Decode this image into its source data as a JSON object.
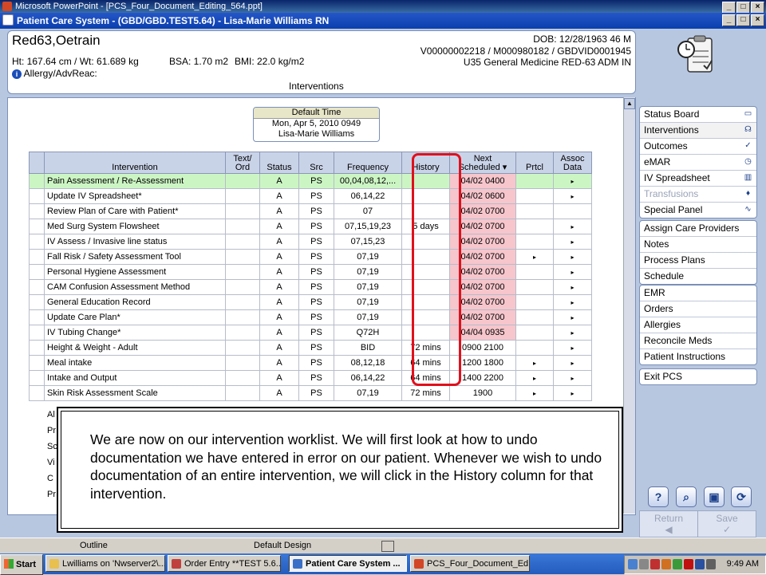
{
  "ppt_window": {
    "title": "Microsoft PowerPoint - [PCS_Four_Document_Editing_564.ppt]"
  },
  "app_window": {
    "title": "Patient Care System - (GBD/GBD.TEST5.64) - Lisa-Marie Williams RN"
  },
  "patient": {
    "name": "Red63,Oetrain",
    "vitals": "Ht: 167.64 cm / Wt: 61.689 kg",
    "bsa": "BSA: 1.70 m2",
    "bmi": "BMI: 22.0 kg/m2",
    "allergy": "Allergy/AdvReac:",
    "dob": "DOB: 12/28/1963 46 M",
    "ids": "V00000002218 / M000980182 / GBDVID0001945",
    "location": "U35 General Medicine  RED-63  ADM IN",
    "screen": "Interventions"
  },
  "default_time": {
    "header": "Default Time",
    "date": "Mon, Apr 5, 2010  0949",
    "user": "Lisa-Marie Williams"
  },
  "table": {
    "headers": {
      "intervention": "Intervention",
      "text1": "Text/",
      "text2": "Ord",
      "status": "Status",
      "src": "Src",
      "frequency": "Frequency",
      "history": "History",
      "next1": "Next",
      "next2": "Scheduled ▾",
      "prtcl": "Prtcl",
      "assoc1": "Assoc",
      "assoc2": "Data"
    },
    "rows": [
      {
        "intervention": "Pain Assessment / Re-Assessment",
        "status": "A",
        "src": "PS",
        "frequency": "00,04,08,12,...",
        "history": "",
        "next": "04/02 0400",
        "prtcl": "",
        "assoc": "▸"
      },
      {
        "intervention": "Update IV Spreadsheet*",
        "status": "A",
        "src": "PS",
        "frequency": "06,14,22",
        "history": "",
        "next": "04/02 0600",
        "prtcl": "",
        "assoc": "▸"
      },
      {
        "intervention": "Review Plan of Care with Patient*",
        "status": "A",
        "src": "PS",
        "frequency": "07",
        "history": "",
        "next": "04/02 0700",
        "prtcl": "",
        "assoc": ""
      },
      {
        "intervention": "Med Surg System Flowsheet",
        "status": "A",
        "src": "PS",
        "frequency": "07,15,19,23",
        "history": "5 days",
        "next": "04/02 0700",
        "prtcl": "",
        "assoc": "▸"
      },
      {
        "intervention": "IV Assess / Invasive line status",
        "status": "A",
        "src": "PS",
        "frequency": "07,15,23",
        "history": "",
        "next": "04/02 0700",
        "prtcl": "",
        "assoc": "▸"
      },
      {
        "intervention": "Fall Risk / Safety Assessment Tool",
        "status": "A",
        "src": "PS",
        "frequency": "07,19",
        "history": "",
        "next": "04/02 0700",
        "prtcl": "▸",
        "assoc": "▸"
      },
      {
        "intervention": "Personal Hygiene Assessment",
        "status": "A",
        "src": "PS",
        "frequency": "07,19",
        "history": "",
        "next": "04/02 0700",
        "prtcl": "",
        "assoc": "▸"
      },
      {
        "intervention": "CAM Confusion Assessment Method",
        "status": "A",
        "src": "PS",
        "frequency": "07,19",
        "history": "",
        "next": "04/02 0700",
        "prtcl": "",
        "assoc": "▸"
      },
      {
        "intervention": "General Education Record",
        "status": "A",
        "src": "PS",
        "frequency": "07,19",
        "history": "",
        "next": "04/02 0700",
        "prtcl": "",
        "assoc": "▸"
      },
      {
        "intervention": "Update Care Plan*",
        "status": "A",
        "src": "PS",
        "frequency": "07,19",
        "history": "",
        "next": "04/02 0700",
        "prtcl": "",
        "assoc": "▸"
      },
      {
        "intervention": "IV Tubing Change*",
        "status": "A",
        "src": "PS",
        "frequency": "Q72H",
        "history": "",
        "next": "04/04 0935",
        "prtcl": "",
        "assoc": "▸"
      },
      {
        "intervention": "Height & Weight - Adult",
        "status": "A",
        "src": "PS",
        "frequency": "BID",
        "history": "72 mins",
        "next": "0900 2100",
        "prtcl": "",
        "assoc": "▸"
      },
      {
        "intervention": "Meal intake",
        "status": "A",
        "src": "PS",
        "frequency": "08,12,18",
        "history": "64 mins",
        "next": "1200 1800",
        "prtcl": "▸",
        "assoc": "▸"
      },
      {
        "intervention": "Intake and Output",
        "status": "A",
        "src": "PS",
        "frequency": "06,14,22",
        "history": "64 mins",
        "next": "1400 2200",
        "prtcl": "▸",
        "assoc": "▸"
      },
      {
        "intervention": "Skin Risk Assessment Scale",
        "status": "A",
        "src": "PS",
        "frequency": "07,19",
        "history": "72 mins",
        "next": "1900",
        "prtcl": "▸",
        "assoc": "▸"
      }
    ],
    "partial_rows": [
      "Al",
      "Pr",
      "Sc",
      "Vi",
      "C",
      "Pr"
    ]
  },
  "side_groups": [
    [
      {
        "label": "Status Board",
        "icon": "board-icon"
      },
      {
        "label": "Interventions",
        "icon": "stethoscope-icon",
        "active": true
      },
      {
        "label": "Outcomes",
        "icon": "checklist-icon"
      },
      {
        "label": "eMAR",
        "icon": "clock-icon"
      },
      {
        "label": "IV Spreadsheet",
        "icon": "iv-icon"
      },
      {
        "label": "Transfusions",
        "icon": "drop-icon",
        "disabled": true
      },
      {
        "label": "Special Panel",
        "icon": "wave-icon"
      }
    ],
    [
      {
        "label": "Assign Care Providers"
      },
      {
        "label": "Notes"
      },
      {
        "label": "Process Plans"
      },
      {
        "label": "Schedule"
      }
    ],
    [
      {
        "label": "EMR"
      },
      {
        "label": "Orders"
      },
      {
        "label": "Allergies"
      },
      {
        "label": "Reconcile Meds"
      },
      {
        "label": "Patient Instructions"
      }
    ],
    [
      {
        "label": "Exit PCS"
      }
    ]
  ],
  "toolbar": {
    "help": "?",
    "return_label": "Return",
    "return_glyph": "◀",
    "save_label": "Save",
    "save_glyph": "✓"
  },
  "ppt_strip": {
    "outline": "Outline",
    "design": "Default Design"
  },
  "taskbar": {
    "start": "Start",
    "tasks": [
      "Lwilliams on 'Nwserver2\\...",
      "Order Entry **TEST 5.6...",
      "Patient Care System ...",
      "PCS_Four_Document_Ed..."
    ],
    "clock": "9:49 AM"
  },
  "overlay": {
    "text": "We are now on our intervention worklist. We will first look at how to undo documentation we have entered in error on our patient. Whenever we wish to undo documentation of an entire intervention, we will click in the History column for that intervention."
  },
  "colors": {
    "selected_row": "#ccf5c4",
    "next_due": "#f6c6cc",
    "history_highlight": "#e0101c",
    "panel_bg": "#b8c7e0"
  }
}
